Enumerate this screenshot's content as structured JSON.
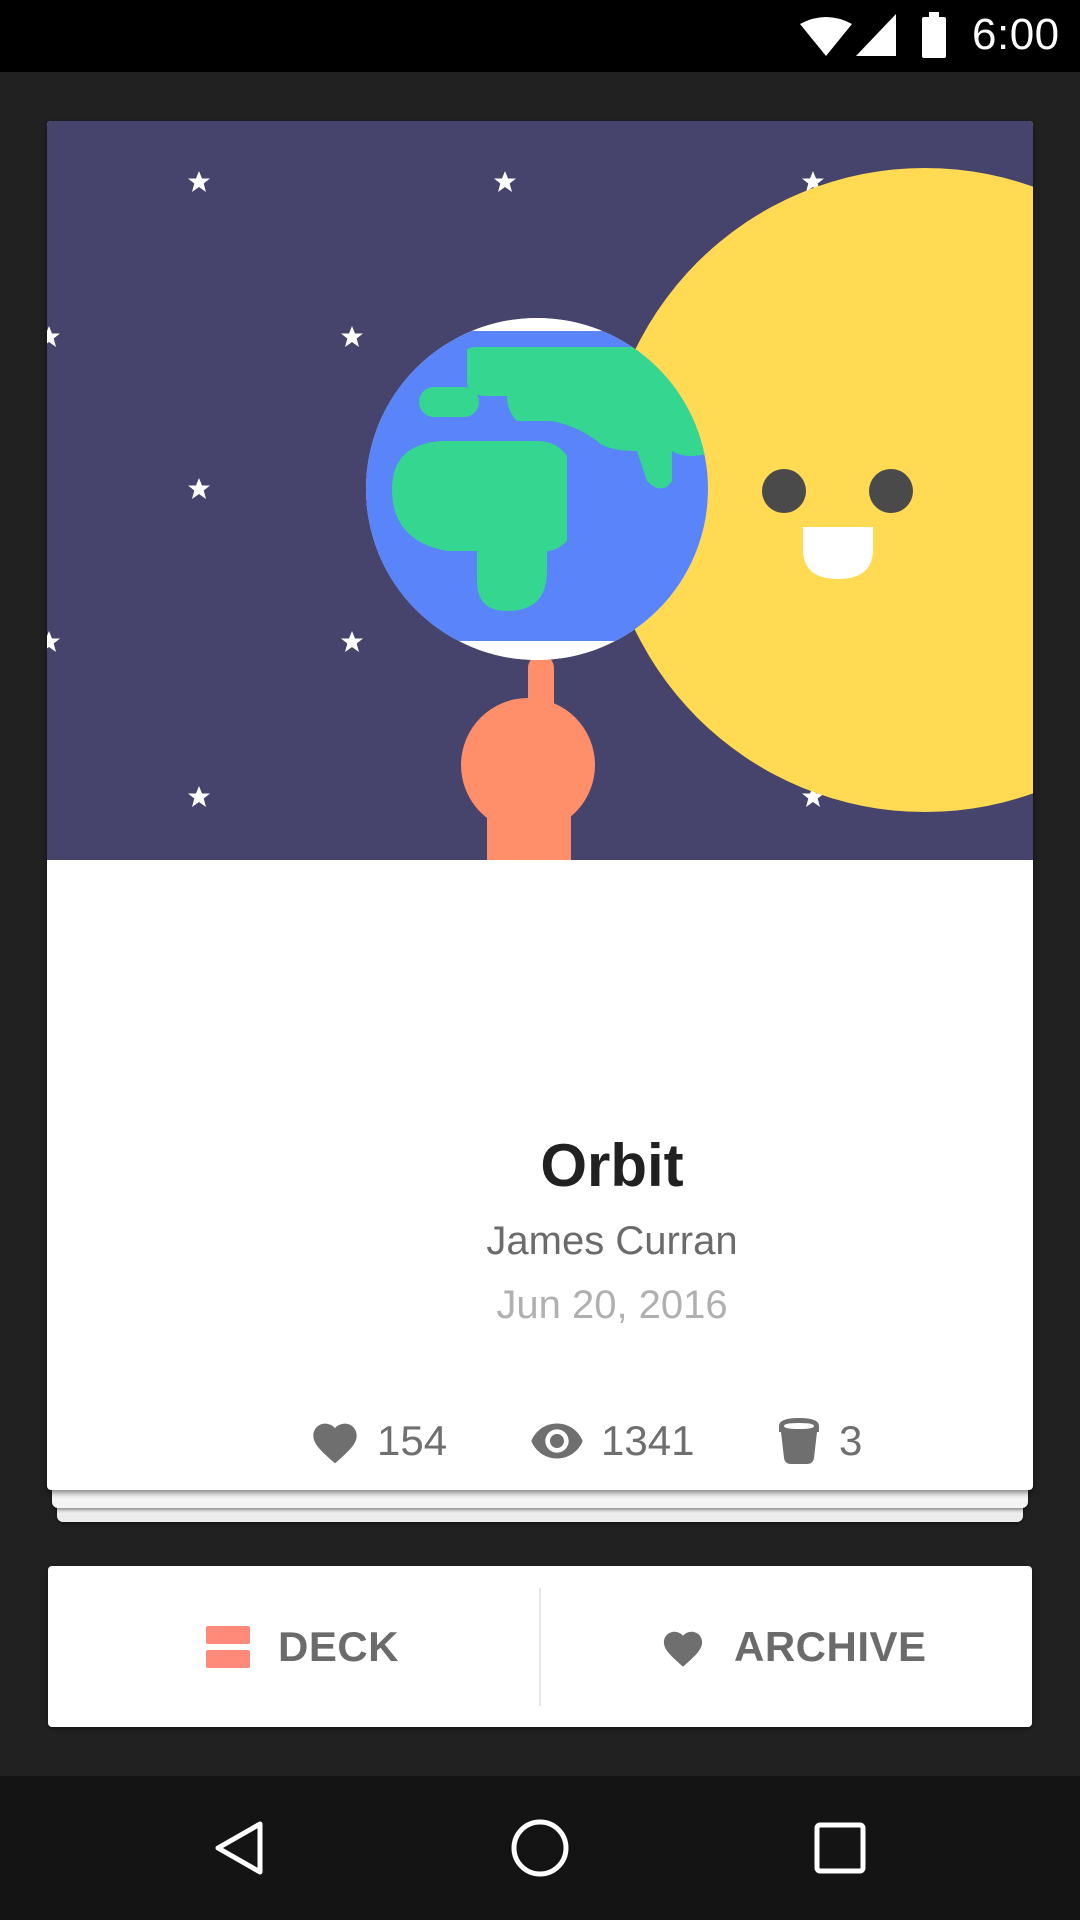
{
  "status_bar": {
    "time": "6:00",
    "icons": [
      "wifi-icon",
      "cell-signal-icon",
      "battery-icon"
    ]
  },
  "card": {
    "title": "Orbit",
    "author": "James Curran",
    "date": "Jun 20, 2016",
    "stats": {
      "likes": "154",
      "views": "1341",
      "buckets": "3"
    },
    "colors": {
      "sky": "#46436c",
      "sun": "#ffda52",
      "ocean": "#5a84fa",
      "land": "#35d690",
      "hand": "#ff8f6b"
    }
  },
  "actions": {
    "deck_label": "DECK",
    "archive_label": "ARCHIVE",
    "deck_icon_color": "#ff8a7a"
  },
  "nav": {
    "icons": [
      "back-icon",
      "home-icon",
      "recents-icon"
    ]
  }
}
